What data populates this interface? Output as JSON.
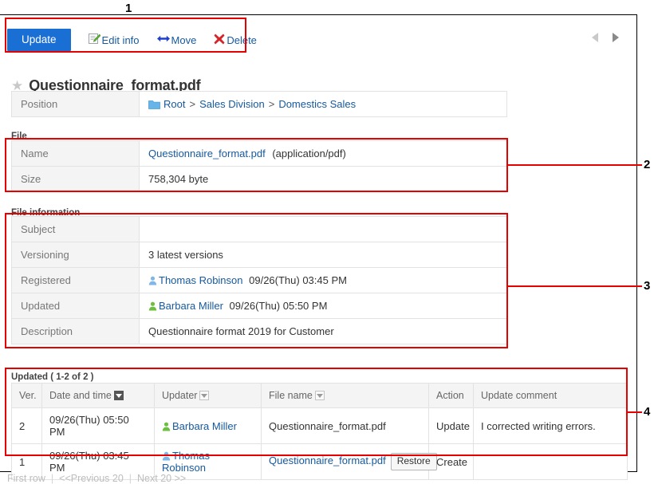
{
  "toolbar": {
    "update_label": "Update",
    "edit_info_label": "Edit info",
    "move_label": "Move",
    "delete_label": "Delete"
  },
  "page_nav": {
    "prev_icon": "prev-arrow-icon",
    "next_icon": "next-arrow-icon"
  },
  "title": {
    "star_icon": "★",
    "text": "Questionnaire_format.pdf"
  },
  "position": {
    "label": "Position",
    "folder_icon": "folder-icon",
    "crumbs": [
      "Root",
      "Sales Division",
      "Domestics Sales"
    ],
    "separator": ">"
  },
  "file_section": {
    "heading": "File",
    "rows": [
      {
        "label": "Name",
        "link": "Questionnaire_format.pdf",
        "suffix": "(application/pdf)"
      },
      {
        "label": "Size",
        "value": "758,304 byte"
      }
    ]
  },
  "file_information": {
    "heading": "File information",
    "rows": [
      {
        "label": "Subject",
        "value": ""
      },
      {
        "label": "Versioning",
        "value": "3  latest versions"
      },
      {
        "label": "Registered",
        "user": "Thomas Robinson",
        "user_icon_color": "#7fb8e8",
        "time": "09/26(Thu) 03:45 PM"
      },
      {
        "label": "Updated",
        "user": "Barbara Miller",
        "user_icon_color": "#6cbf3f",
        "time": "09/26(Thu) 05:50 PM"
      },
      {
        "label": "Description",
        "value": "Questionnaire format 2019 for Customer"
      }
    ]
  },
  "history": {
    "heading": "Updated ( 1-2 of 2 )",
    "columns": [
      {
        "label": "Ver.",
        "sort": "none"
      },
      {
        "label": "Date and time",
        "sort": "active"
      },
      {
        "label": "Updater",
        "sort": "idle"
      },
      {
        "label": "File name",
        "sort": "idle"
      },
      {
        "label": "Action",
        "sort": "none"
      },
      {
        "label": "Update comment",
        "sort": "none"
      }
    ],
    "rows": [
      {
        "ver": "2",
        "datetime": "09/26(Thu) 05:50 PM",
        "updater": "Barbara Miller",
        "updater_icon_color": "#6cbf3f",
        "filename": "Questionnaire_format.pdf",
        "filename_is_link": false,
        "restore_label": "",
        "action": "Update",
        "comment": "I corrected writing errors."
      },
      {
        "ver": "1",
        "datetime": "09/26(Thu) 03:45 PM",
        "updater": "Thomas Robinson",
        "updater_icon_color": "#7fb8e8",
        "filename": "Questionnaire_format.pdf",
        "filename_is_link": true,
        "restore_label": "Restore",
        "action": "Create",
        "comment": ""
      }
    ]
  },
  "pager": {
    "first_row": "First row",
    "previous": "<<Previous 20",
    "next": "Next 20 >>",
    "divider": "|"
  },
  "annotations": {
    "n1": "1",
    "n2": "2",
    "n3": "3",
    "n4": "4"
  },
  "colors": {
    "accent_blue": "#1a6fd4",
    "link_blue": "#15599e",
    "annotation_red": "#e60000"
  }
}
